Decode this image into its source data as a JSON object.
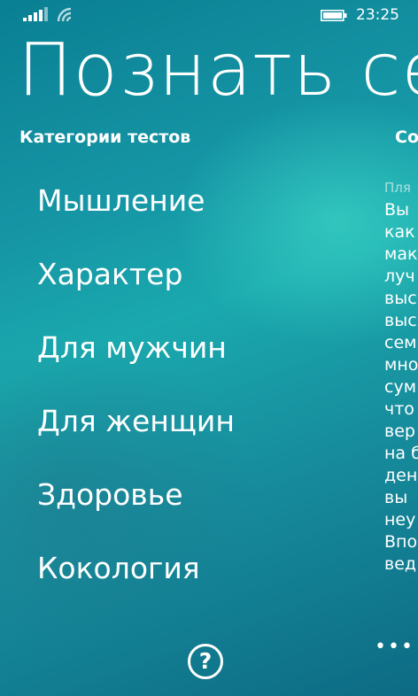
{
  "status_bar": {
    "time": "23:25",
    "icons": [
      "signal-icon",
      "wifi-icon",
      "battery-icon"
    ]
  },
  "app": {
    "title": "Познать себя"
  },
  "pivot": {
    "left_header": "Категории тестов",
    "right_header_partial": "Co"
  },
  "categories": [
    {
      "label": "Мышление"
    },
    {
      "label": "Характер"
    },
    {
      "label": "Для мужчин"
    },
    {
      "label": "Для женщин"
    },
    {
      "label": "Здоровье"
    },
    {
      "label": "Кокология"
    }
  ],
  "side_panel": {
    "caption": "Пля",
    "lines": [
      "Вы",
      "как",
      "мак",
      "луч",
      "выс",
      "выс",
      "сем",
      "мно",
      "сум",
      "что",
      "вер",
      "на б",
      "ден",
      "вы",
      "неу",
      "Впо",
      "вед"
    ]
  },
  "app_bar": {
    "help_label": "?",
    "more_label": "•••"
  },
  "colors": {
    "background_dark": "#0a7f93",
    "background_light": "#1aa9ae",
    "highlight": "#46e1cd",
    "text": "#ffffff"
  }
}
